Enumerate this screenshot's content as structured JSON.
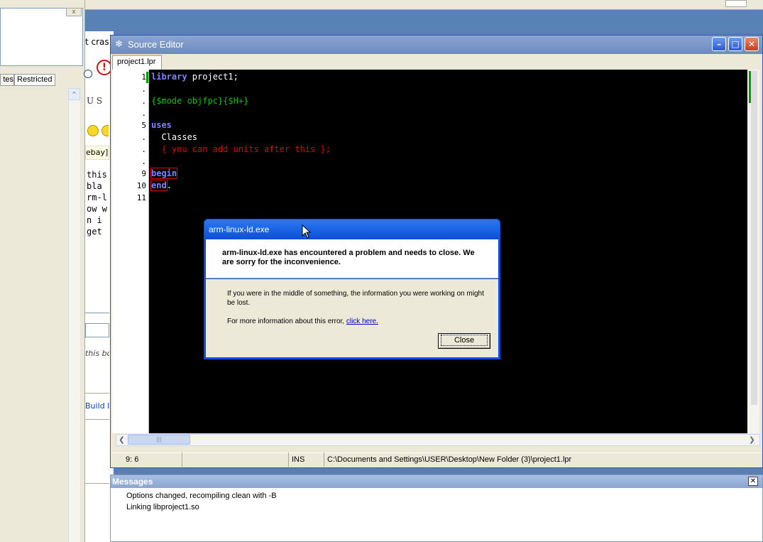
{
  "left_panel": {
    "tabs": [
      "tes",
      "Restricted"
    ],
    "scroll_up_glyph": "^",
    "close_glyph": "x"
  },
  "background_window": {
    "snippet_top": "t cras",
    "us_glyphs": "U S",
    "ebay_fragment": "ebay]l",
    "text_lines": [
      "this",
      " bla",
      "rm-l",
      "ow w",
      "n i",
      " get"
    ],
    "italic_fragment": "this bo",
    "build_link": "Build l"
  },
  "source_editor": {
    "title": "Source Editor",
    "tab_label": "project1.lpr",
    "gutter": [
      "1",
      ".",
      ".",
      ".",
      "5",
      ".",
      ".",
      ".",
      "9",
      "10",
      "11"
    ],
    "code_lines": [
      [
        {
          "t": "library",
          "c": "kw"
        },
        {
          "t": " project1;",
          "c": "id"
        }
      ],
      [],
      [
        {
          "t": "{$mode objfpc}{$H+}",
          "c": "dir"
        }
      ],
      [],
      [
        {
          "t": "uses",
          "c": "kw"
        }
      ],
      [
        {
          "t": "  Classes",
          "c": "id"
        }
      ],
      [
        {
          "t": "  { you can add units after this };",
          "c": "cm"
        }
      ],
      [],
      [
        {
          "t": "begin",
          "c": "kw boxed"
        }
      ],
      [
        {
          "t": "end",
          "c": "kw boxed"
        },
        {
          "t": ".",
          "c": "id"
        }
      ],
      []
    ],
    "status": {
      "cursor": "9:  6",
      "mode": "INS",
      "path": "C:\\Documents and Settings\\USER\\Desktop\\New Folder (3)\\project1.lpr"
    }
  },
  "dialog": {
    "title": "arm-linux-ld.exe",
    "message": "arm-linux-ld.exe has encountered a problem and needs to close.  We are sorry for the inconvenience.",
    "info": "If you were in the middle of something, the information you were working on might be lost.",
    "more_prefix": "For more information about this error, ",
    "more_link": "click here.",
    "close_label": "Close"
  },
  "messages": {
    "title": "Messages",
    "lines": [
      "Options changed, recompiling clean with -B",
      "Linking libproject1.so"
    ]
  }
}
